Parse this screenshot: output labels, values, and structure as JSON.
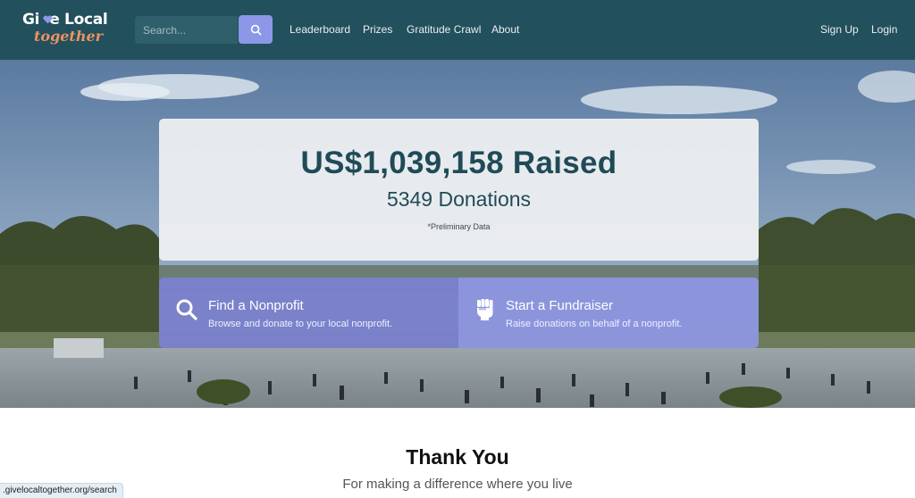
{
  "brand": {
    "logo_line1": "Give Local",
    "logo_line2": "together",
    "heart_color": "#8d97e8",
    "accent_color": "#e99363"
  },
  "nav": {
    "search_placeholder": "Search...",
    "links": [
      "Leaderboard",
      "Prizes",
      "Gratitude Crawl",
      "About"
    ],
    "sign_up": "Sign Up",
    "login": "Login"
  },
  "stats": {
    "raised": "US$1,039,158 Raised",
    "donations": "5349 Donations",
    "note": "*Preliminary Data"
  },
  "actions": [
    {
      "title": "Find a Nonprofit",
      "desc": "Browse and donate to your local nonprofit.",
      "icon": "search-icon"
    },
    {
      "title": "Start a Fundraiser",
      "desc": "Raise donations on behalf of a nonprofit.",
      "icon": "raised-fist-icon"
    }
  ],
  "thanks": {
    "title": "Thank You",
    "subtitle": "For making a difference where you live"
  },
  "status_bar": {
    "url": ".givelocaltogether.org/search"
  },
  "colors": {
    "navbar": "#22505c",
    "primary_text": "#1f4b57",
    "button": "#8d97e8"
  }
}
